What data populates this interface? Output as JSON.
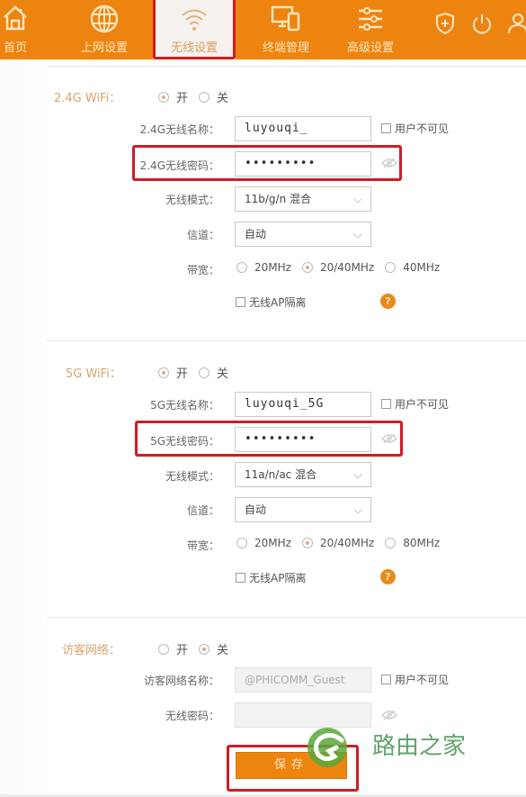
{
  "nav": {
    "items": [
      {
        "label": "首页",
        "icon": "home-icon",
        "active": false
      },
      {
        "label": "上网设置",
        "icon": "globe-icon",
        "active": false
      },
      {
        "label": "无线设置",
        "icon": "wifi-icon",
        "active": true
      },
      {
        "label": "终端管理",
        "icon": "devices-icon",
        "active": false
      },
      {
        "label": "高级设置",
        "icon": "sliders-icon",
        "active": false
      }
    ],
    "right_icons": [
      "shield-plus-icon",
      "power-icon",
      "user-icon"
    ]
  },
  "wifi24": {
    "section_label": "2.4G WiFi：",
    "enabled_options": [
      {
        "label": "开",
        "checked": true
      },
      {
        "label": "关",
        "checked": false
      }
    ],
    "ssid_label": "2.4G无线名称：",
    "ssid_value": "luyouqi_",
    "hidden_label": "用户不可见",
    "hidden_checked": false,
    "password_label": "2.4G无线密码：",
    "password_value": "•••••••••",
    "mode_label": "无线模式：",
    "mode_value": "11b/g/n 混合",
    "channel_label": "信道：",
    "channel_value": "自动",
    "bandwidth_label": "带宽：",
    "bandwidth_options": [
      {
        "label": "20MHz",
        "checked": false
      },
      {
        "label": "20/40MHz",
        "checked": true
      },
      {
        "label": "40MHz",
        "checked": false
      }
    ],
    "ap_isolation_label": "无线AP隔离",
    "ap_isolation_checked": false,
    "help": "?"
  },
  "wifi5": {
    "section_label": "5G WiFi：",
    "enabled_options": [
      {
        "label": "开",
        "checked": true
      },
      {
        "label": "关",
        "checked": false
      }
    ],
    "ssid_label": "5G无线名称：",
    "ssid_value": "luyouqi_5G",
    "hidden_label": "用户不可见",
    "hidden_checked": false,
    "password_label": "5G无线密码：",
    "password_value": "•••••••••",
    "mode_label": "无线模式：",
    "mode_value": "11a/n/ac 混合",
    "channel_label": "信道：",
    "channel_value": "自动",
    "bandwidth_label": "带宽：",
    "bandwidth_options": [
      {
        "label": "20MHz",
        "checked": false
      },
      {
        "label": "20/40MHz",
        "checked": true
      },
      {
        "label": "80MHz",
        "checked": false
      }
    ],
    "ap_isolation_label": "无线AP隔离",
    "ap_isolation_checked": false,
    "help": "?"
  },
  "guest": {
    "section_label": "访客网络：",
    "enabled_options": [
      {
        "label": "开",
        "checked": false
      },
      {
        "label": "关",
        "checked": true
      }
    ],
    "ssid_label": "访客网络名称：",
    "ssid_placeholder": "@PHICOMM_Guest",
    "hidden_label": "用户不可见",
    "hidden_checked": false,
    "password_label": "无线密码：",
    "password_value": ""
  },
  "save_label": "保存",
  "watermark": {
    "text": "路由之家"
  },
  "colors": {
    "brand_orange": "#ee8410",
    "highlight_red": "#d01c24",
    "section_label": "#d9a46a",
    "watermark_green": "#4e9a5c"
  }
}
